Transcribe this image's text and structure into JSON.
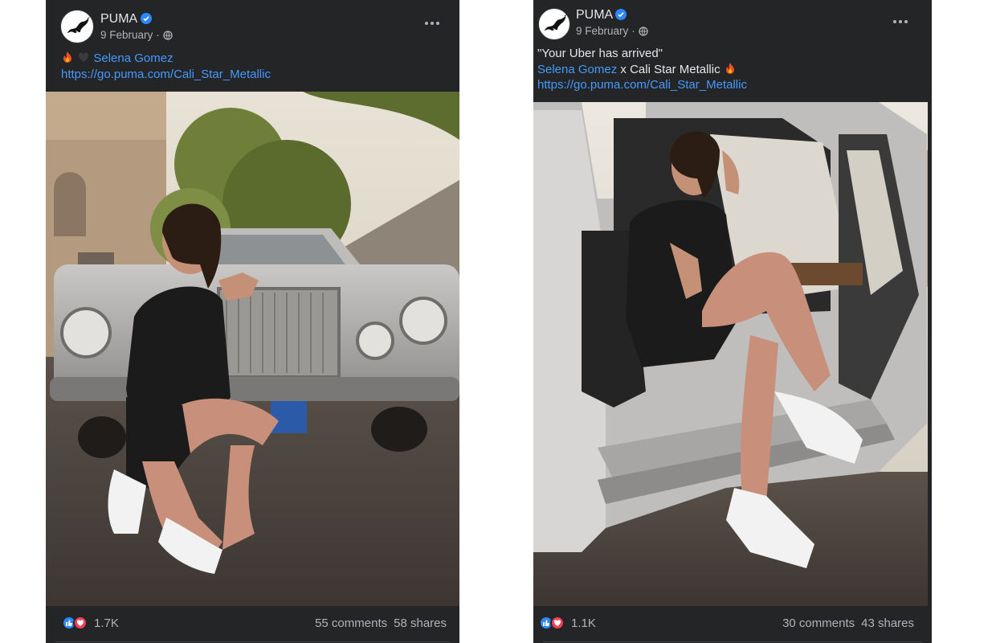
{
  "posts": [
    {
      "page_name": "PUMA",
      "verified": true,
      "date": "9 February",
      "separator": "·",
      "privacy_icon": "globe-icon",
      "caption": {
        "emojis": [
          "fire-emoji",
          "black-heart-emoji"
        ],
        "mention": "Selena Gomez",
        "link": "https://go.puma.com/Cali_Star_Metallic"
      },
      "reaction_icons": [
        "like-icon",
        "love-icon"
      ],
      "reactions_count": "1.7K",
      "comments": "55 comments",
      "shares": "58 shares"
    },
    {
      "page_name": "PUMA",
      "verified": true,
      "date": "9 February",
      "separator": "·",
      "privacy_icon": "globe-icon",
      "caption": {
        "quote": "\"Your Uber has arrived\"",
        "mention": "Selena Gomez",
        "after_mention": " x Cali Star Metallic",
        "emojis": [
          "fire-emoji"
        ],
        "link": "https://go.puma.com/Cali_Star_Metallic"
      },
      "reaction_icons": [
        "like-icon",
        "love-icon"
      ],
      "reactions_count": "1.1K",
      "comments": "30 comments",
      "shares": "43 shares"
    }
  ],
  "colors": {
    "card_bg": "#242526",
    "text_primary": "#e4e6eb",
    "text_secondary": "#b0b3b8",
    "link": "#4599ff",
    "verified": "#2d88ff",
    "like": "#2d88ff",
    "love": "#f33e58"
  }
}
